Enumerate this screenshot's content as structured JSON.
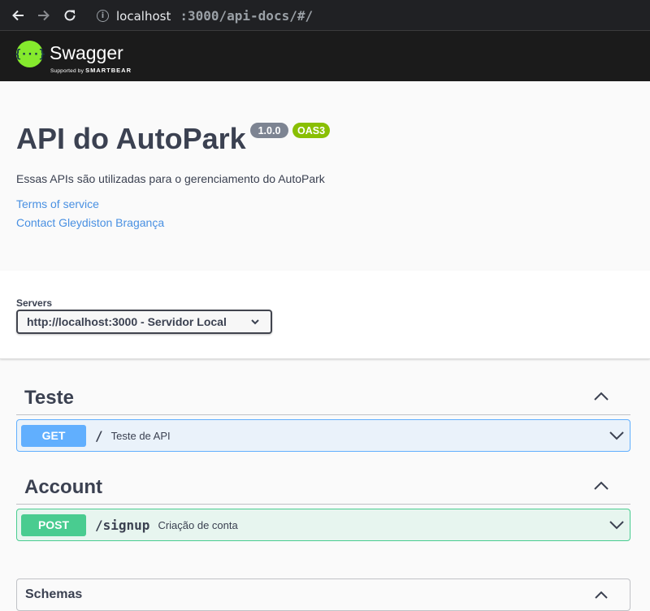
{
  "browser": {
    "url_host": "localhost",
    "url_path": ":3000/api-docs/#/",
    "icons": [
      "back-arrow-icon",
      "forward-arrow-icon",
      "reload-icon",
      "info-icon"
    ]
  },
  "topbar": {
    "logo_glyph": "{···}",
    "logo_text": "Swagger",
    "logo_sub_prefix": "Supported by ",
    "logo_sub_brand": "SMARTBEAR"
  },
  "info": {
    "title": "API do AutoPark",
    "version": "1.0.0",
    "oas": "OAS3",
    "description": "Essas APIs são utilizadas para o gerenciamento do AutoPark",
    "terms_link": "Terms of service",
    "contact_link": "Contact Gleydiston Bragança"
  },
  "servers": {
    "label": "Servers",
    "selected": "http://localhost:3000 - Servidor Local"
  },
  "tags": [
    {
      "name": "Teste",
      "operations": [
        {
          "method": "GET",
          "path": "/",
          "summary": "Teste de API"
        }
      ]
    },
    {
      "name": "Account",
      "operations": [
        {
          "method": "POST",
          "path": "/signup",
          "summary": "Criação de conta"
        }
      ]
    }
  ],
  "schemas": {
    "label": "Schemas"
  },
  "colors": {
    "get": "#61affe",
    "post": "#49cc90",
    "link": "#4990e2",
    "swagger_green": "#85ea2d",
    "oas_badge": "#89bf04",
    "version_badge": "#7d8492"
  }
}
